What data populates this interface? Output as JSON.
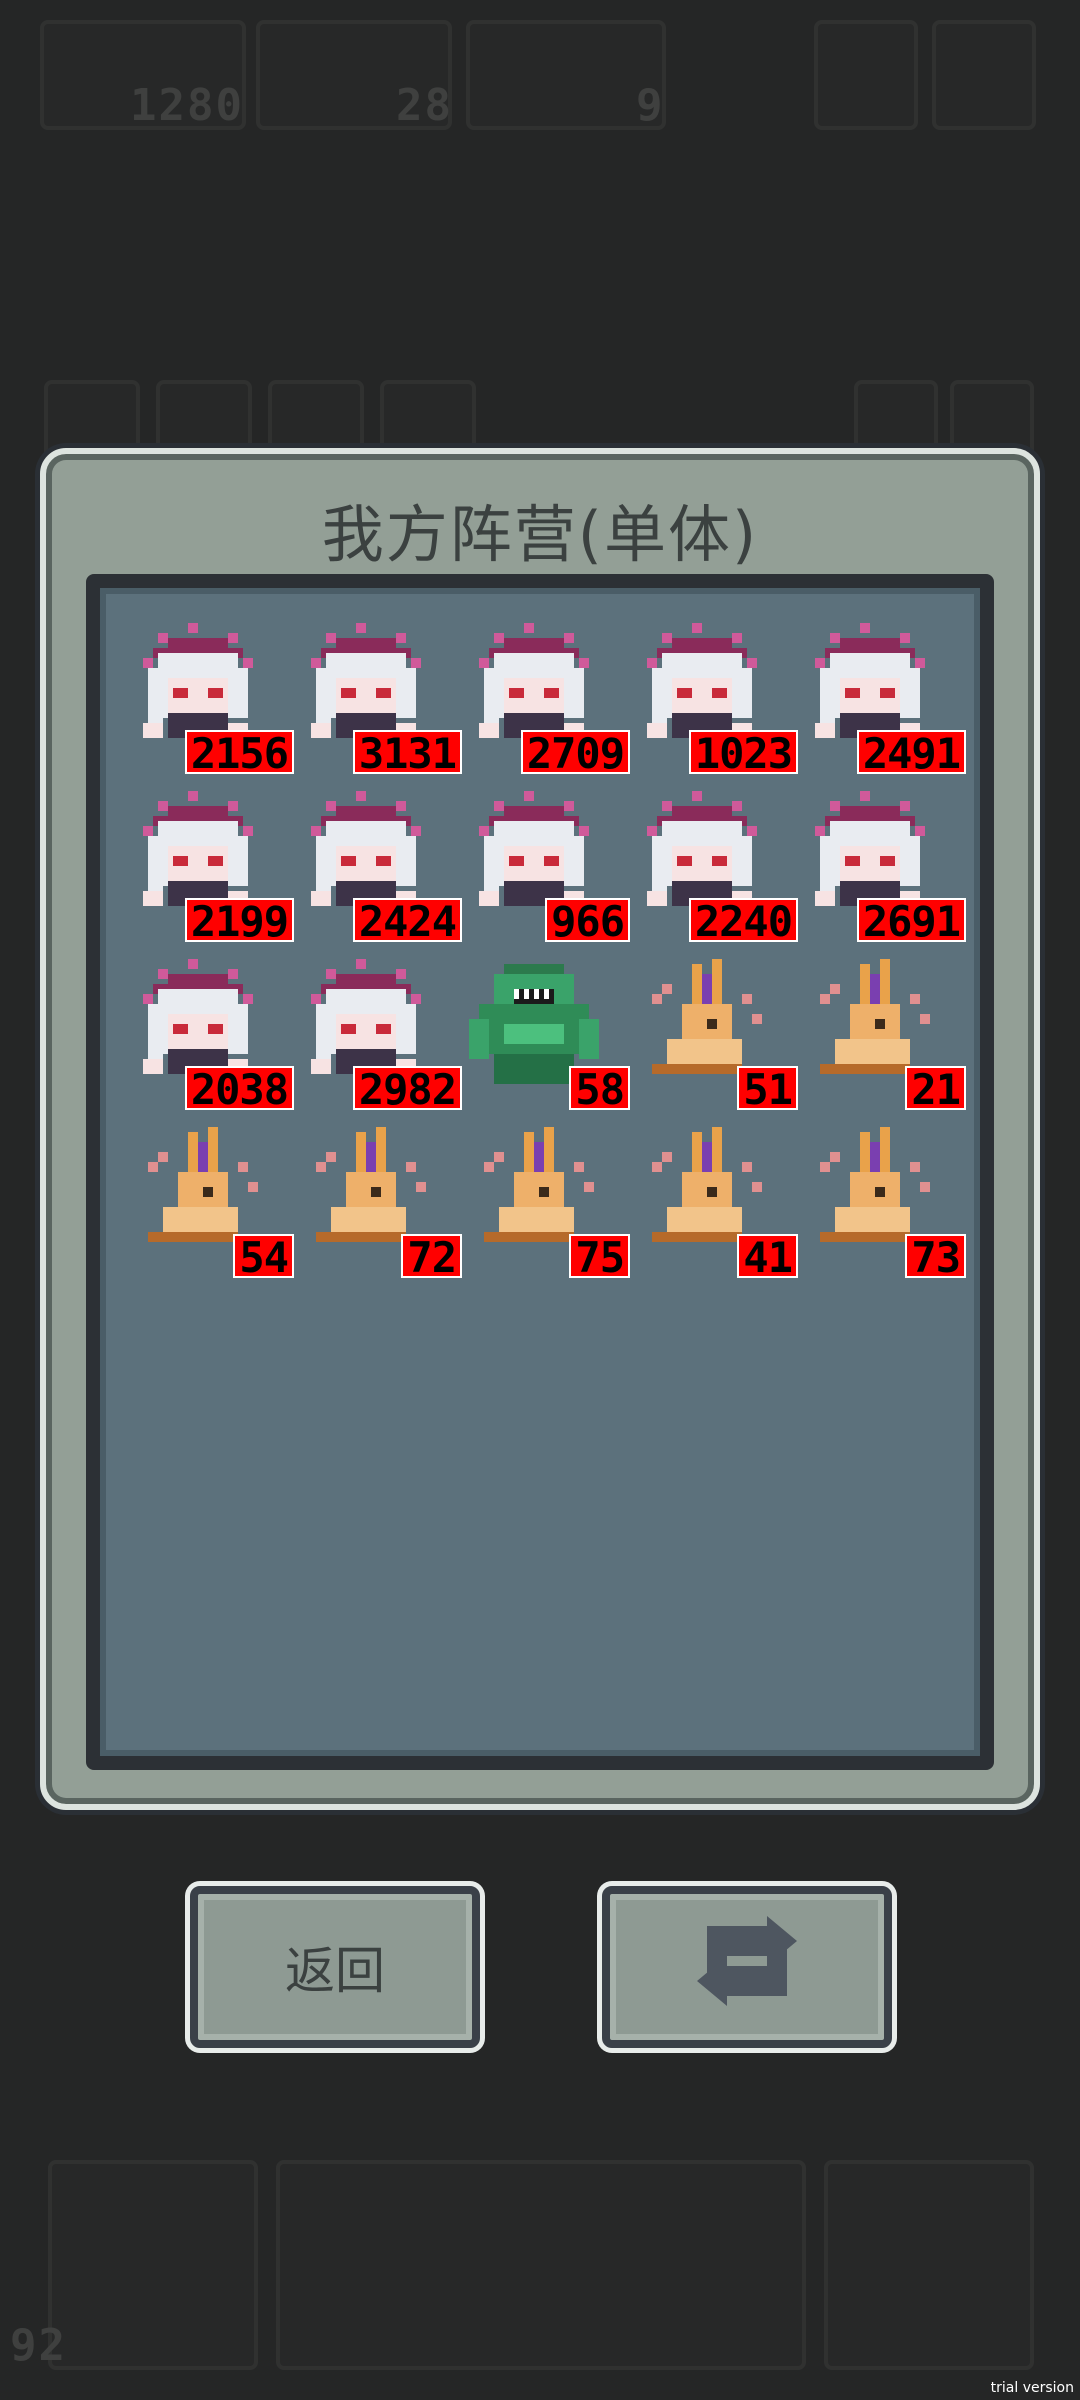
{
  "hud": {
    "resource_1_value": "1280",
    "resource_2_value": "28",
    "resource_3_value": "9",
    "bottom_left_value": "92"
  },
  "modal": {
    "title": "我方阵营(单体)"
  },
  "units": [
    {
      "type": "girl",
      "count": "2156"
    },
    {
      "type": "girl",
      "count": "3131"
    },
    {
      "type": "girl",
      "count": "2709"
    },
    {
      "type": "girl",
      "count": "1023"
    },
    {
      "type": "girl",
      "count": "2491"
    },
    {
      "type": "girl",
      "count": "2199"
    },
    {
      "type": "girl",
      "count": "2424"
    },
    {
      "type": "girl",
      "count": "966"
    },
    {
      "type": "girl",
      "count": "2240"
    },
    {
      "type": "girl",
      "count": "2691"
    },
    {
      "type": "girl",
      "count": "2038"
    },
    {
      "type": "girl",
      "count": "2982"
    },
    {
      "type": "monster",
      "count": "58"
    },
    {
      "type": "rabbit",
      "count": "51"
    },
    {
      "type": "rabbit",
      "count": "21"
    },
    {
      "type": "rabbit",
      "count": "54"
    },
    {
      "type": "rabbit",
      "count": "72"
    },
    {
      "type": "rabbit",
      "count": "75"
    },
    {
      "type": "rabbit",
      "count": "41"
    },
    {
      "type": "rabbit",
      "count": "73"
    }
  ],
  "buttons": {
    "back_label": "返回",
    "refresh_icon": "refresh-icon"
  },
  "watermark": "trial version",
  "colors": {
    "count_badge": "#ff0000",
    "panel": "#939f96",
    "inner_panel": "#5c717c"
  }
}
